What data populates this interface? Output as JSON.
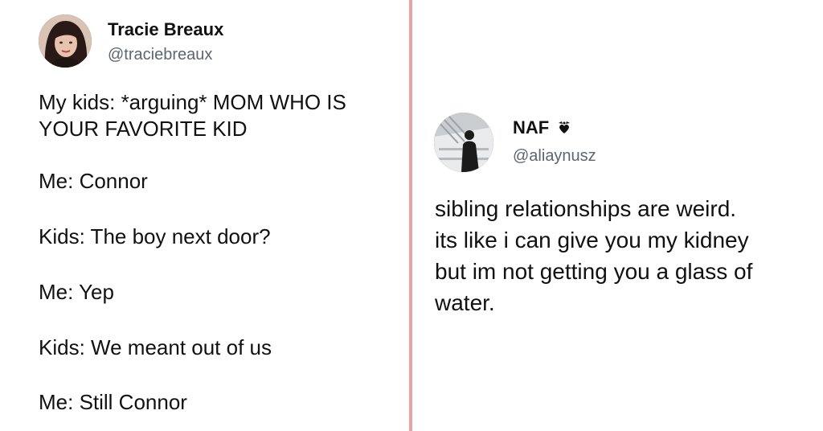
{
  "left_tweet": {
    "display_name": "Tracie Breaux",
    "handle": "@traciebreaux",
    "lines": [
      "My kids: *arguing* MOM WHO IS",
      "YOUR FAVORITE KID",
      "Me: Connor",
      "Kids: The boy next door?",
      "Me: Yep",
      "Kids: We meant out of us",
      "Me: Still Connor"
    ]
  },
  "right_tweet": {
    "display_name": "NAF",
    "handle": "@aliaynusz",
    "lines": [
      "sibling relationships are weird.",
      "its like i can give you my kidney",
      "but im not getting you a glass of",
      "water."
    ]
  },
  "colors": {
    "divider": "#e9a3a3",
    "handle": "#5b6670",
    "text": "#111111"
  },
  "icons": {
    "name_badge": "heart-with-bow-icon"
  }
}
